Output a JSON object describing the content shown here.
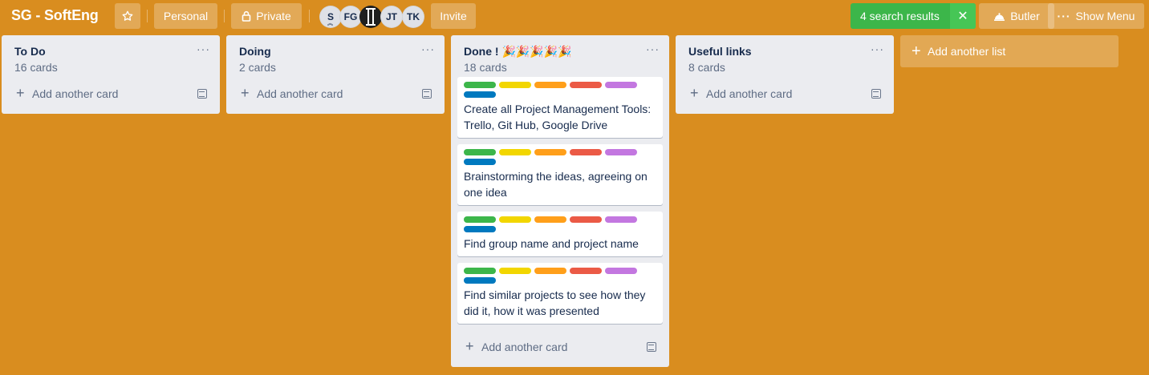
{
  "header": {
    "title": "SG - SoftEng",
    "star_icon": "star-icon",
    "personal_label": "Personal",
    "private_label": "Private",
    "lock_icon": "lock-icon",
    "members": [
      "S",
      "FG",
      "",
      "JT",
      "TK"
    ],
    "invite_label": "Invite",
    "search_results_label": "4 search results",
    "butler_label": "Butler",
    "show_menu_label": "Show Menu"
  },
  "lists": [
    {
      "name": "To Do",
      "count": "16 cards",
      "add_card": "Add another card"
    },
    {
      "name": "Doing",
      "count": "2 cards",
      "add_card": "Add another card"
    },
    {
      "name": "Done ! 🎉🎉🎉🎉🎉",
      "count": "18 cards",
      "add_card": "Add another card",
      "cards": [
        {
          "title": "Create all Project Management Tools: Trello, Git Hub, Google Drive"
        },
        {
          "title": "Brainstorming the ideas, agreeing on one idea"
        },
        {
          "title": "Find group name and project name"
        },
        {
          "title": "Find similar projects to see how they did it, how it was presented"
        }
      ]
    },
    {
      "name": "Useful links",
      "count": "8 cards",
      "add_card": "Add another card"
    }
  ],
  "add_list_label": "Add another list",
  "label_colors": [
    "#3cb64a",
    "#f2d600",
    "#ff9f1a",
    "#eb5a46",
    "#c377e0",
    "#0079bf"
  ],
  "colors": {
    "board_background": "#d98d1f",
    "search_green": "#3cb64a"
  }
}
